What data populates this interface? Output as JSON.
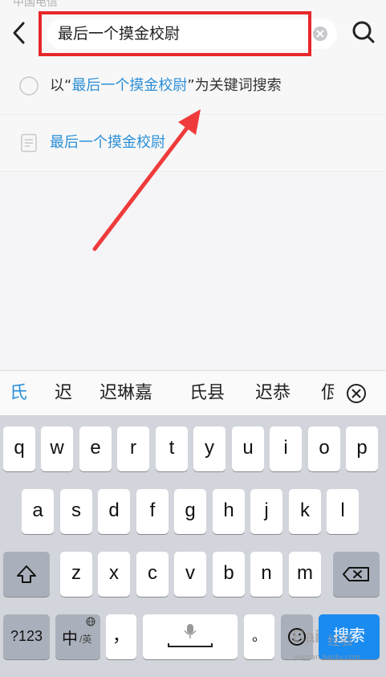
{
  "status_bar": {
    "partial_text": "中国电信"
  },
  "search": {
    "query": "最后一个摸金校尉"
  },
  "suggestions": [
    {
      "prefix": "以“",
      "keyword": "最后一个摸金校尉",
      "suffix": "”为关键词搜索",
      "icon": "search-circle-icon"
    },
    {
      "keyword": "最后一个摸金校尉",
      "icon": "document-icon"
    }
  ],
  "candidates": [
    "氏",
    "迟",
    "迟琳嘉",
    "氏县",
    "迟恭",
    "佤"
  ],
  "keyboard": {
    "row1": [
      "q",
      "w",
      "e",
      "r",
      "t",
      "y",
      "u",
      "i",
      "o",
      "p"
    ],
    "row2": [
      "a",
      "s",
      "d",
      "f",
      "g",
      "h",
      "j",
      "k",
      "l"
    ],
    "row3": [
      "z",
      "x",
      "c",
      "v",
      "b",
      "n",
      "m"
    ],
    "numbers_label": "?123",
    "lang_label_main": "中",
    "lang_label_sub": "/英",
    "comma_label": "，",
    "period_label": "。",
    "search_label": "搜索"
  },
  "watermark": {
    "main": "Bai",
    "sub": "经验",
    "url": "jingyan.baidu.com"
  },
  "colors": {
    "accent": "#2b8fd8",
    "highlight": "#e8262a",
    "search_key": "#1a8bf0"
  }
}
